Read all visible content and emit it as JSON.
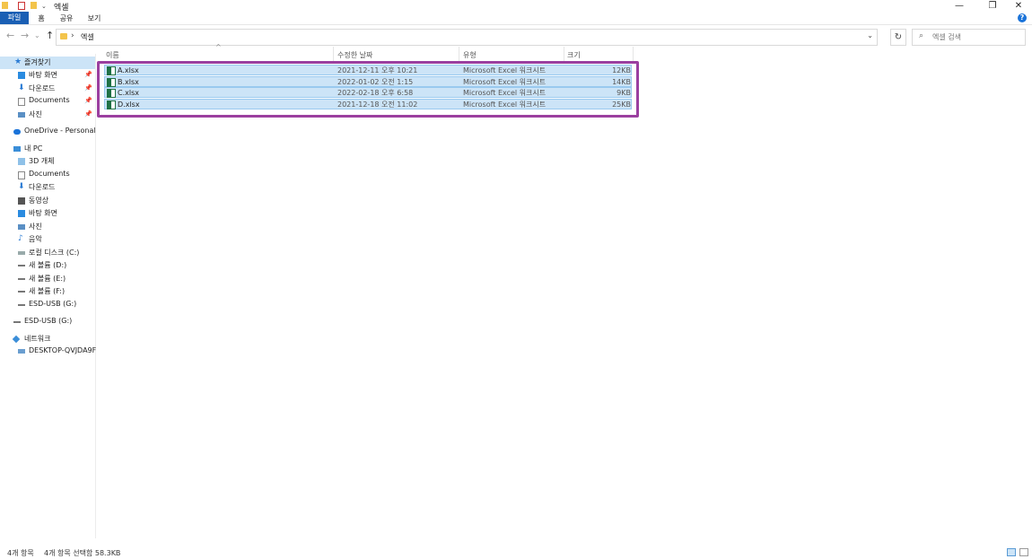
{
  "window": {
    "title": "엑셀",
    "controls": {
      "minimize": "—",
      "restore": "❐",
      "close": "✕"
    }
  },
  "ribbon": {
    "tabs": [
      "파일",
      "홈",
      "공유",
      "보기"
    ],
    "help": "?"
  },
  "address": {
    "path": "엑셀",
    "separator": "›",
    "dropdown": "⌄",
    "refresh": "↻"
  },
  "search": {
    "placeholder": "엑셀 검색"
  },
  "nav": {
    "quick_access": "즐겨찾기",
    "quick_items": [
      "바탕 화면",
      "다운로드",
      "Documents",
      "사진"
    ],
    "onedrive": "OneDrive - Personal",
    "this_pc": "내 PC",
    "pc_items": [
      "3D 개체",
      "Documents",
      "다운로드",
      "동영상",
      "바탕 화면",
      "사진",
      "음악",
      "로컬 디스크 (C:)",
      "새 볼륨 (D:)",
      "새 볼륨 (E:)",
      "새 볼륨 (F:)",
      "ESD-USB (G:)"
    ],
    "usb": "ESD-USB (G:)",
    "network": "네트워크",
    "network_items": [
      "DESKTOP-QVJDA9F"
    ]
  },
  "columns": [
    "이름",
    "수정한 날짜",
    "유형",
    "크기"
  ],
  "files": [
    {
      "name": "A.xlsx",
      "modified": "2021-12-11 오후 10:21",
      "type": "Microsoft Excel 워크시트",
      "size": "12KB"
    },
    {
      "name": "B.xlsx",
      "modified": "2022-01-02 오전 1:15",
      "type": "Microsoft Excel 워크시트",
      "size": "14KB"
    },
    {
      "name": "C.xlsx",
      "modified": "2022-02-18 오후 6:58",
      "type": "Microsoft Excel 워크시트",
      "size": "9KB"
    },
    {
      "name": "D.xlsx",
      "modified": "2021-12-18 오전 11:02",
      "type": "Microsoft Excel 워크시트",
      "size": "25KB"
    }
  ],
  "status": {
    "item_count": "4개 항목",
    "selection": "4개 항목 선택함 58.3KB"
  },
  "colors": {
    "selection_outline": "#9b3fa0",
    "row_selected": "#cce4f7",
    "file_tab": "#1a5fb4",
    "excel_green": "#1e7145",
    "folder_yellow": "#f3c44b"
  }
}
